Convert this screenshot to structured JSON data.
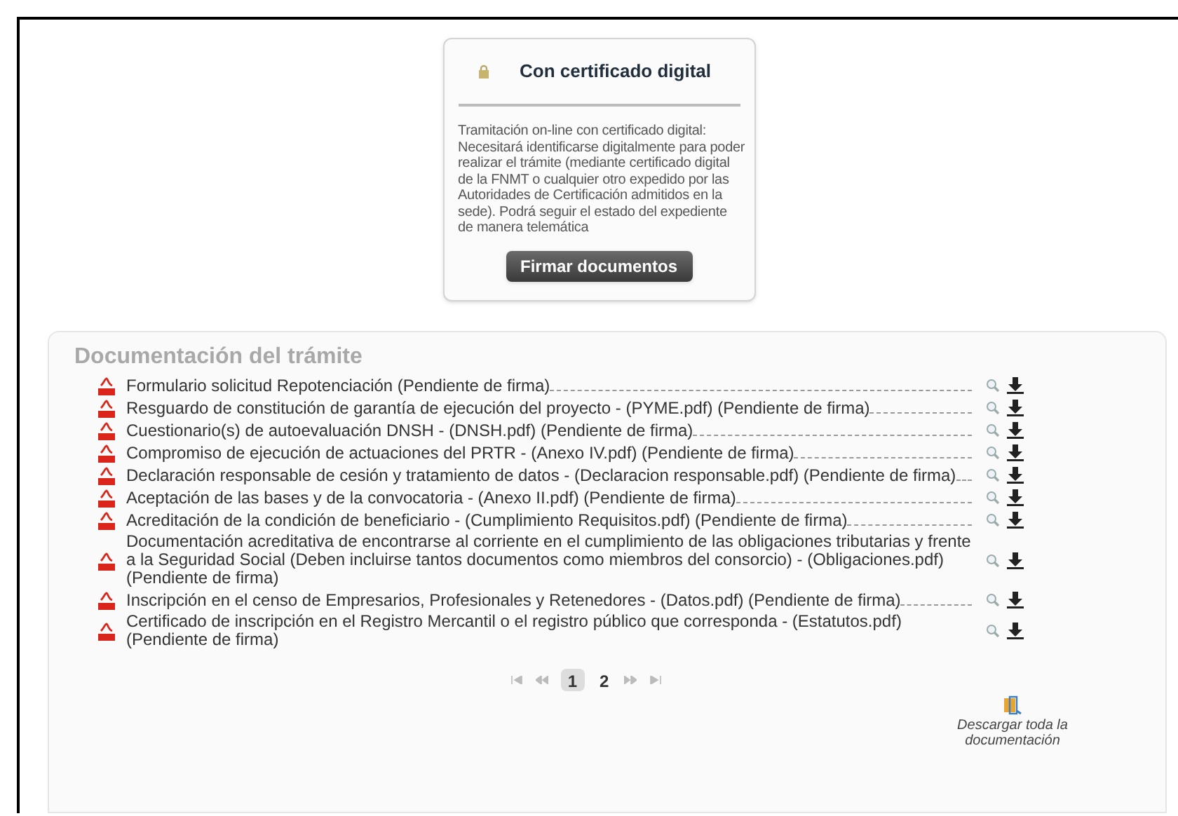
{
  "cert_card": {
    "title": "Con certificado digital",
    "description": "Tramitación on-line con certificado digital: Necesitará identificarse digitalmente para poder realizar el trámite (mediante certificado digital de la FNMT o cualquier otro expedido por las Autoridades de Certificación admitidos en la sede). Podrá seguir el estado del expediente de manera telemática",
    "button": "Firmar documentos"
  },
  "documents": {
    "title": "Documentación del trámite",
    "items": [
      {
        "label": "Formulario solicitud Repotenciación (Pendiente de firma)"
      },
      {
        "label": "Resguardo de constitución de garantía de ejecución del proyecto - (PYME.pdf) (Pendiente de firma)"
      },
      {
        "label": "Cuestionario(s) de autoevaluación DNSH - (DNSH.pdf) (Pendiente de firma)"
      },
      {
        "label": "Compromiso de ejecución de actuaciones del PRTR - (Anexo IV.pdf) (Pendiente de firma)"
      },
      {
        "label": "Declaración responsable de cesión y tratamiento de datos - (Declaracion responsable.pdf) (Pendiente de firma)"
      },
      {
        "label": "Aceptación de las bases y de la convocatoria - (Anexo II.pdf) (Pendiente de firma)"
      },
      {
        "label": "Acreditación de la condición de beneficiario - (Cumplimiento Requisitos.pdf) (Pendiente de firma)"
      },
      {
        "label": "Documentación acreditativa de encontrarse al corriente en el cumplimiento de las obligaciones tributarias y frente a la Seguridad Social (Deben incluirse tantos documentos como miembros del consorcio) - (Obligaciones.pdf) (Pendiente de firma)"
      },
      {
        "label": "Inscripción en el censo de Empresarios, Profesionales y Retenedores - (Datos.pdf) (Pendiente de firma)"
      },
      {
        "label": "Certificado de inscripción en el Registro Mercantil o el registro público que corresponda - (Estatutos.pdf) (Pendiente de firma)"
      }
    ],
    "pagination": {
      "pages": [
        {
          "label": "1",
          "selected": true
        },
        {
          "label": "2",
          "selected": false
        }
      ]
    },
    "download_all": "Descargar toda la documentación"
  }
}
